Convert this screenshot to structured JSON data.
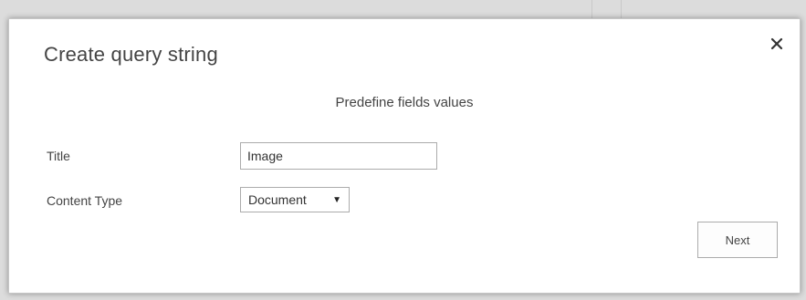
{
  "dialog": {
    "title": "Create query string",
    "subtitle": "Predefine fields values",
    "close_icon": "close-icon"
  },
  "fields": {
    "title": {
      "label": "Title",
      "value": "Image"
    },
    "content_type": {
      "label": "Content Type",
      "selected": "Document",
      "arrow_icon": "dropdown-arrow-icon"
    }
  },
  "actions": {
    "next_label": "Next"
  },
  "colors": {
    "dialog_background": "#ffffff",
    "backdrop": "#dcdcdc",
    "text": "#444444",
    "border": "#ababab"
  }
}
